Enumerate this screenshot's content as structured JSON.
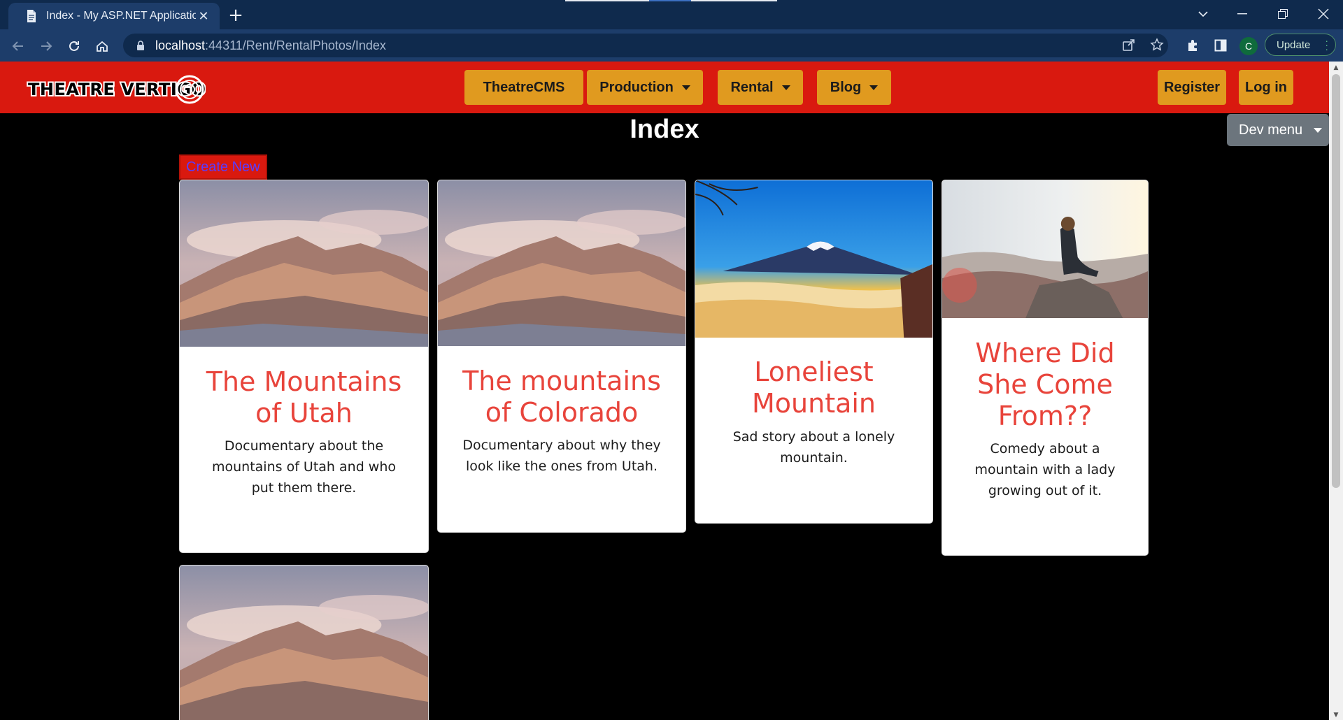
{
  "browser": {
    "tab_title": "Index - My ASP.NET Application",
    "url_host": "localhost",
    "url_rest": ":44311/Rent/RentalPhotos/Index",
    "update_label": "Update",
    "profile_initial": "C"
  },
  "site": {
    "logo_text": "THEATRE VERTIGO",
    "nav": {
      "theatrecms": "TheatreCMS",
      "production": "Production",
      "rental": "Rental",
      "blog": "Blog",
      "register": "Register",
      "login": "Log in"
    },
    "dev_menu": "Dev menu"
  },
  "page": {
    "title": "Index",
    "create_new": "Create New"
  },
  "cards": [
    {
      "title": "The Mountains of Utah",
      "description": "Documentary about the mountains of Utah and who put them there.",
      "image": "snowy-mountain-sunset"
    },
    {
      "title": "The mountains of Colorado",
      "description": "Documentary about why they look like the ones from Utah.",
      "image": "snowy-mountain-sunset"
    },
    {
      "title": "Loneliest Mountain",
      "description": "Sad story about a lonely mountain.",
      "image": "mount-fuji"
    },
    {
      "title": "Where Did She Come From??",
      "description": "Comedy about a mountain with a lady growing out of it.",
      "image": "woman-on-rock"
    },
    {
      "title": "",
      "description": "",
      "image": "snowy-mountain-sunset"
    }
  ],
  "colors": {
    "navbar_red": "#d9190f",
    "button_orange": "#e09a1f",
    "card_title_red": "#e8443b",
    "chrome_dark": "#0f2a4d",
    "chrome_mid": "#1d3d6a"
  }
}
